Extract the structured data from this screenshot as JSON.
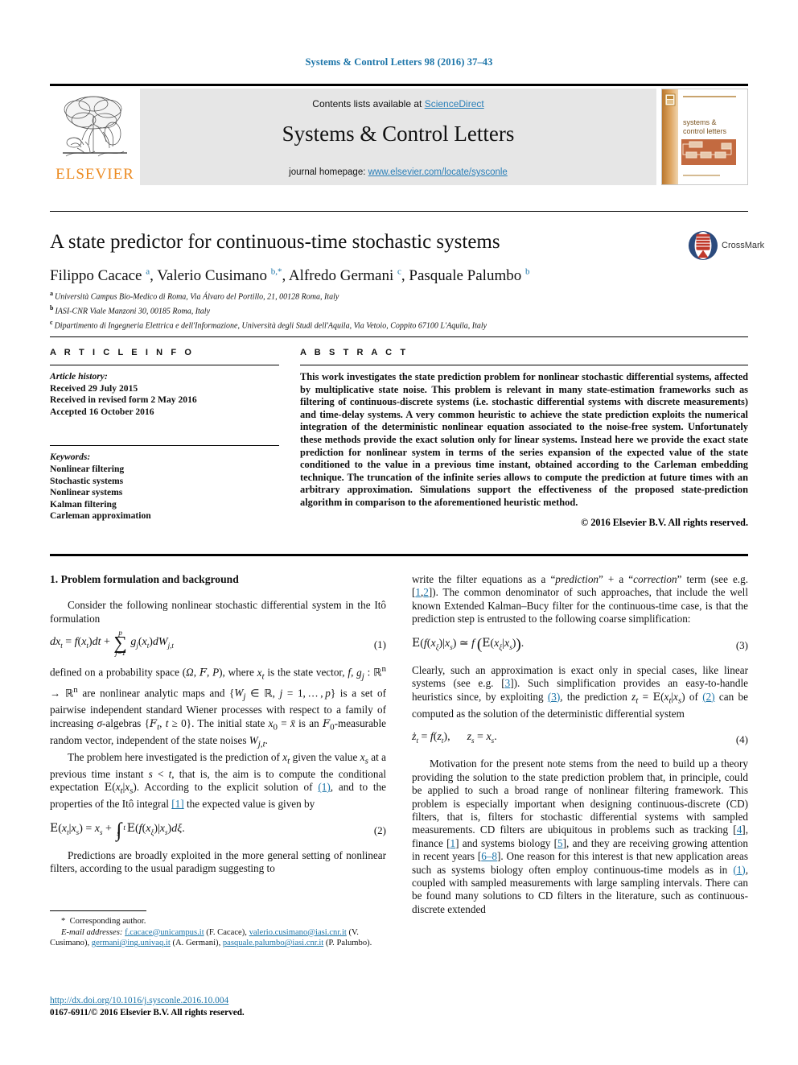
{
  "running_head": "Systems & Control Letters 98 (2016) 37–43",
  "masthead": {
    "contents_prefix": "Contents lists available at ",
    "contents_link": "ScienceDirect",
    "journal_name": "Systems & Control Letters",
    "homepage_prefix": "journal homepage: ",
    "homepage_url": "www.elsevier.com/locate/sysconle",
    "publisher_logo_text": "ELSEVIER",
    "cover": {
      "line1": "systems &",
      "line2": "control letters"
    }
  },
  "crossmark": {
    "label": "CrossMark"
  },
  "article": {
    "title": "A state predictor for continuous-time stochastic systems",
    "authors_html": "Filippo Cacace <sup>a</sup>, Valerio Cusimano <sup>b,*</sup>, Alfredo Germani <sup>c</sup>, Pasquale Palumbo <sup>b</sup>",
    "affiliations": [
      {
        "mark": "a",
        "text": "Università Campus Bio-Medico di Roma, Via Álvaro del Portillo, 21, 00128 Roma, Italy"
      },
      {
        "mark": "b",
        "text": "IASI-CNR Viale Manzoni 30, 00185 Roma, Italy"
      },
      {
        "mark": "c",
        "text": "Dipartimento di Ingegneria Elettrica e dell'Informazione, Università degli Studi dell'Aquila, Via Vetoio, Coppito 67100 L'Aquila, Italy"
      }
    ]
  },
  "info": {
    "heading": "A R T I C L E   I N F O",
    "history_label": "Article history:",
    "history": [
      "Received 29 July 2015",
      "Received in revised form 2 May 2016",
      "Accepted 16 October 2016"
    ],
    "keywords_label": "Keywords:",
    "keywords": [
      "Nonlinear filtering",
      "Stochastic systems",
      "Nonlinear systems",
      "Kalman filtering",
      "Carleman approximation"
    ]
  },
  "abstract": {
    "heading": "A B S T R A C T",
    "text": "This work investigates the state prediction problem for nonlinear stochastic differential systems, affected by multiplicative state noise. This problem is relevant in many state-estimation frameworks such as filtering of continuous-discrete systems (i.e. stochastic differential systems with discrete measurements) and time-delay systems. A very common heuristic to achieve the state prediction exploits the numerical integration of the deterministic nonlinear equation associated to the noise-free system. Unfortunately these methods provide the exact solution only for linear systems. Instead here we provide the exact state prediction for nonlinear system in terms of the series expansion of the expected value of the state conditioned to the value in a previous time instant, obtained according to the Carleman embedding technique. The truncation of the infinite series allows to compute the prediction at future times with an arbitrary approximation. Simulations support the effectiveness of the proposed state-prediction algorithm in comparison to the aforementioned heuristic method.",
    "copyright": "© 2016 Elsevier B.V. All rights reserved."
  },
  "body": {
    "section_title": "1. Problem formulation and background",
    "left": {
      "p1": "Consider the following nonlinear stochastic differential system in the Itô formulation",
      "eq1_num": "(1)",
      "p2_html": "defined on a probability space (<i>Ω</i>, <span class=\"bb\">F</span>, <i>P</i>), where <i>x<sub>t</sub></i> is the state vector, <i>f</i>, <i>g<sub>j</sub></i> : ℝ<sup>n</sup> → ℝ<sup>n</sup> are nonlinear analytic maps and {<i>W<sub>j</sub></i> ∈ ℝ, <i>j</i> = 1,…,<i>p</i>} is a set of pairwise independent standard Wiener processes with respect to a family of increasing <i>σ</i>-algebras {<span class=\"bb\">F</span><i><sub>t</sub></i>, <i>t</i> ≥ 0}. The initial state <i>x</i><sub>0</sub> = <i>x̄</i> is an <span class=\"bb\">F</span><sub>0</sub>-measurable random vector, independent of the state noises <i>W<sub>j,t</sub></i>.",
      "p3_html": "The problem here investigated is the prediction of <i>x<sub>t</sub></i> given the value <i>x<sub>s</sub></i> at a previous time instant <i>s</i> &lt; <i>t</i>, that is, the aim is to compute the conditional expectation <span class=\"bb\">E</span>(<i>x<sub>t</sub></i>|<i>x<sub>s</sub></i>). According to the explicit solution of [REF1], and to the properties of the Itô integral [1] the expected value is given by",
      "eq2_num": "(2)",
      "p4": "Predictions are broadly exploited in the more general setting of nonlinear filters, according to the usual paradigm suggesting to"
    },
    "right": {
      "p1_html": "write the filter equations as a “prediction” + a “correction” term (see e.g. [1,2]). The common denominator of such approaches, that include the well known Extended Kalman–Bucy filter for the continuous-time case, is that the prediction step is entrusted to the following coarse simplification:",
      "eq3_num": "(3)",
      "p2_html": "Clearly, such an approximation is exact only in special cases, like linear systems (see e.g. [3]). Such simplification provides an easy-to-handle heuristics since, by exploiting (3), the prediction z_t = E(x_t|x_s) of (2) can be computed as the solution of the deterministic differential system",
      "eq4_num": "(4)",
      "p3_html": "Motivation for the present note stems from the need to build up a theory providing the solution to the state prediction problem that, in principle, could be applied to such a broad range of nonlinear filtering framework. This problem is especially important when designing continuous-discrete (CD) filters, that is, filters for stochastic differential systems with sampled measurements. CD filters are ubiquitous in problems such as tracking [4], finance [1] and systems biology [5], and they are receiving growing attention in recent years [6–8]. One reason for this interest is that new application areas such as systems biology often employ continuous-time models as in (1), coupled with sampled measurements with large sampling intervals. There can be found many solutions to CD filters in the literature, such as continuous-discrete extended"
    }
  },
  "footnote": {
    "corresponding": "Corresponding author.",
    "email_label": "E-mail addresses:",
    "emails": [
      {
        "addr": "f.cacace@unicampus.it",
        "who": "(F. Cacace)"
      },
      {
        "addr": "valerio.cusimano@iasi.cnr.it",
        "who": "(V. Cusimano)"
      },
      {
        "addr": "germani@ing.univaq.it",
        "who": "(A. Germani)"
      },
      {
        "addr": "pasquale.palumbo@iasi.cnr.it",
        "who": "(P. Palumbo)."
      }
    ]
  },
  "doi": {
    "url": "http://dx.doi.org/10.1016/j.sysconle.2016.10.004",
    "issn_line": "0167-6911/© 2016 Elsevier B.V. All rights reserved."
  },
  "colors": {
    "link": "#1b74a8",
    "elsevier_orange": "#ec8b22",
    "masthead_bg": "#e6e6e6"
  }
}
